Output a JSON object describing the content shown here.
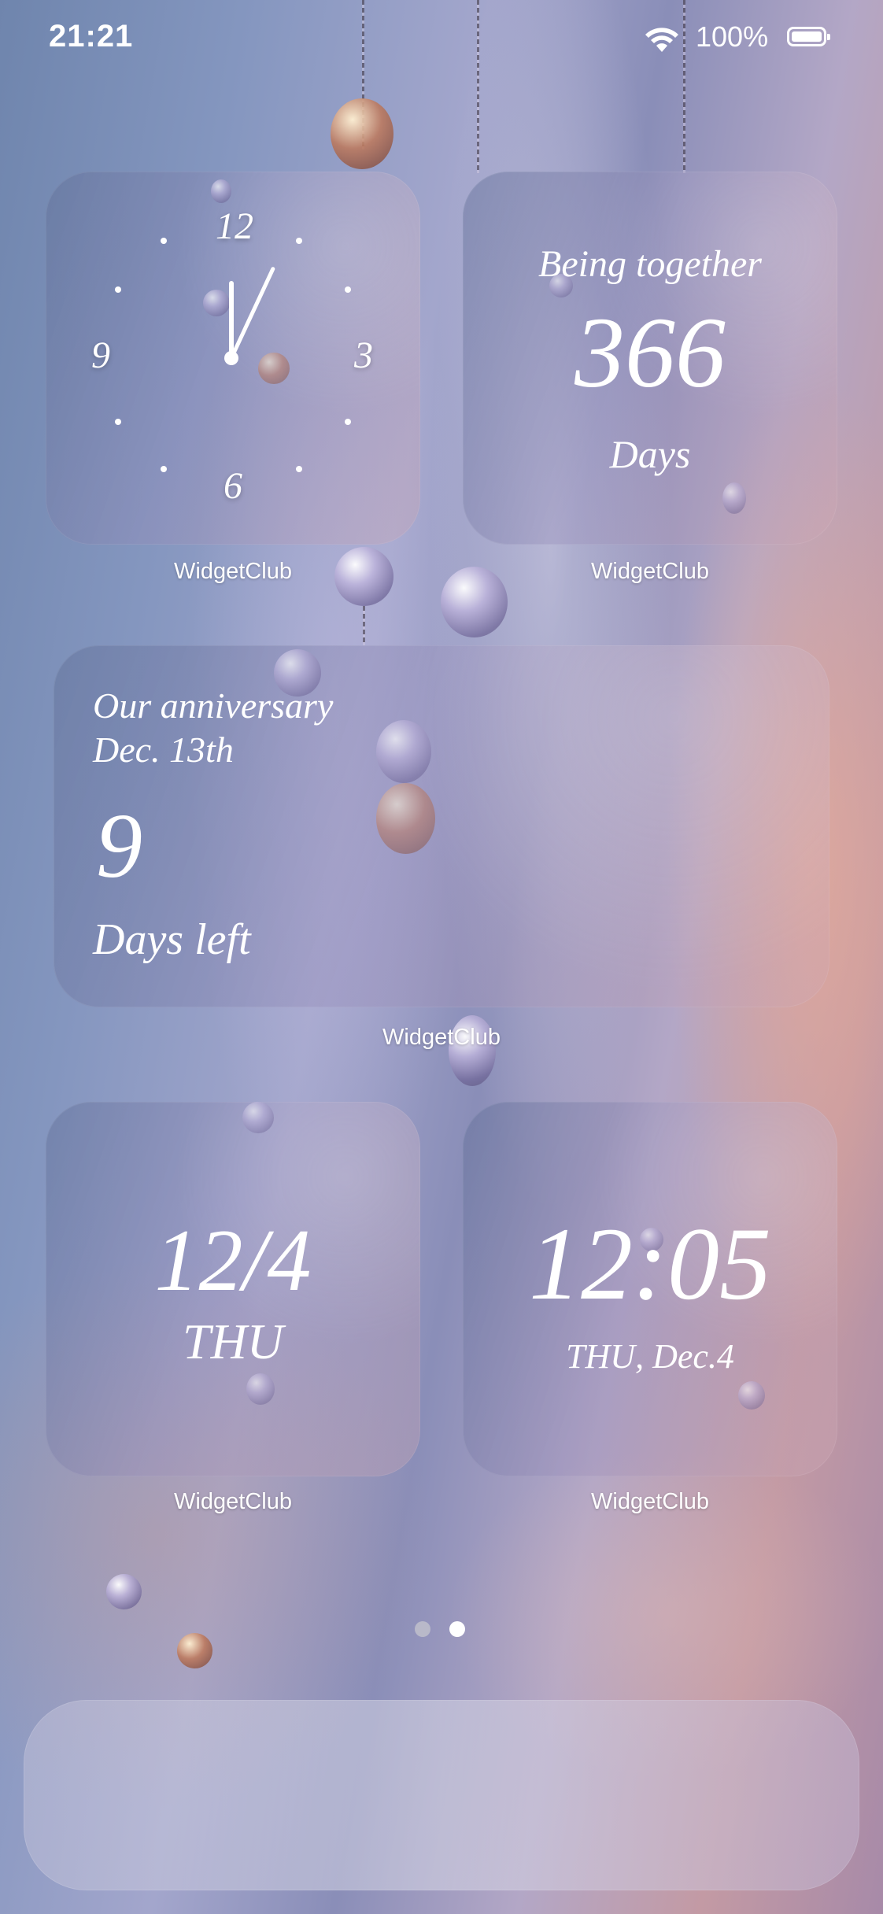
{
  "status_bar": {
    "time": "21:21",
    "battery_percent": "100%",
    "wifi_icon": "wifi-icon",
    "battery_icon": "battery-full-icon"
  },
  "widgets": {
    "clock": {
      "numerals": [
        "12",
        "3",
        "6",
        "9"
      ],
      "hour_hand_angle_deg": 0,
      "minute_hand_angle_deg": 25,
      "caption": "WidgetClub"
    },
    "together": {
      "title": "Being together",
      "count": "366",
      "unit": "Days",
      "caption": "WidgetClub"
    },
    "anniversary": {
      "title": "Our anniversary",
      "date": "Dec. 13th",
      "count": "9",
      "unit": "Days left",
      "caption": "WidgetClub"
    },
    "date": {
      "date": "12/4",
      "weekday": "THU",
      "caption": "WidgetClub"
    },
    "digital_clock": {
      "time": "12:05",
      "date": "THU, Dec.4",
      "caption": "WidgetClub"
    }
  },
  "page_indicator": {
    "pages": 2,
    "current_page": 2,
    "inactive_color": "#b9b9c9",
    "active_color": "#ffffff"
  },
  "dock": {
    "apps": []
  }
}
